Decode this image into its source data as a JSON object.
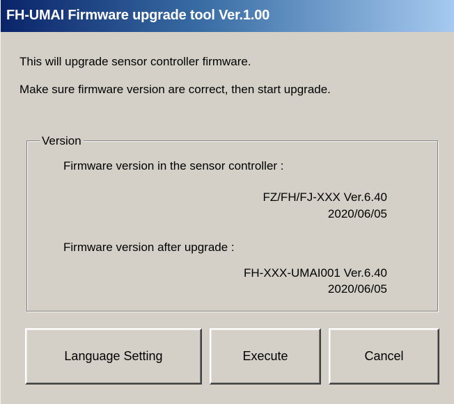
{
  "window": {
    "title": "FH-UMAI Firmware upgrade tool Ver.1.00"
  },
  "message": {
    "line1": "This will upgrade sensor controller firmware.",
    "line2": "Make sure firmware version are correct, then start upgrade."
  },
  "version": {
    "legend": "Version",
    "controller_label": "Firmware version in the sensor controller :",
    "controller_version": "FZ/FH/FJ-XXX Ver.6.40",
    "controller_date": "2020/06/05",
    "after_label": "Firmware version after upgrade :",
    "after_version": "FH-XXX-UMAI001 Ver.6.40",
    "after_date": "2020/06/05"
  },
  "buttons": {
    "language_setting": "Language Setting",
    "execute": "Execute",
    "cancel": "Cancel"
  }
}
